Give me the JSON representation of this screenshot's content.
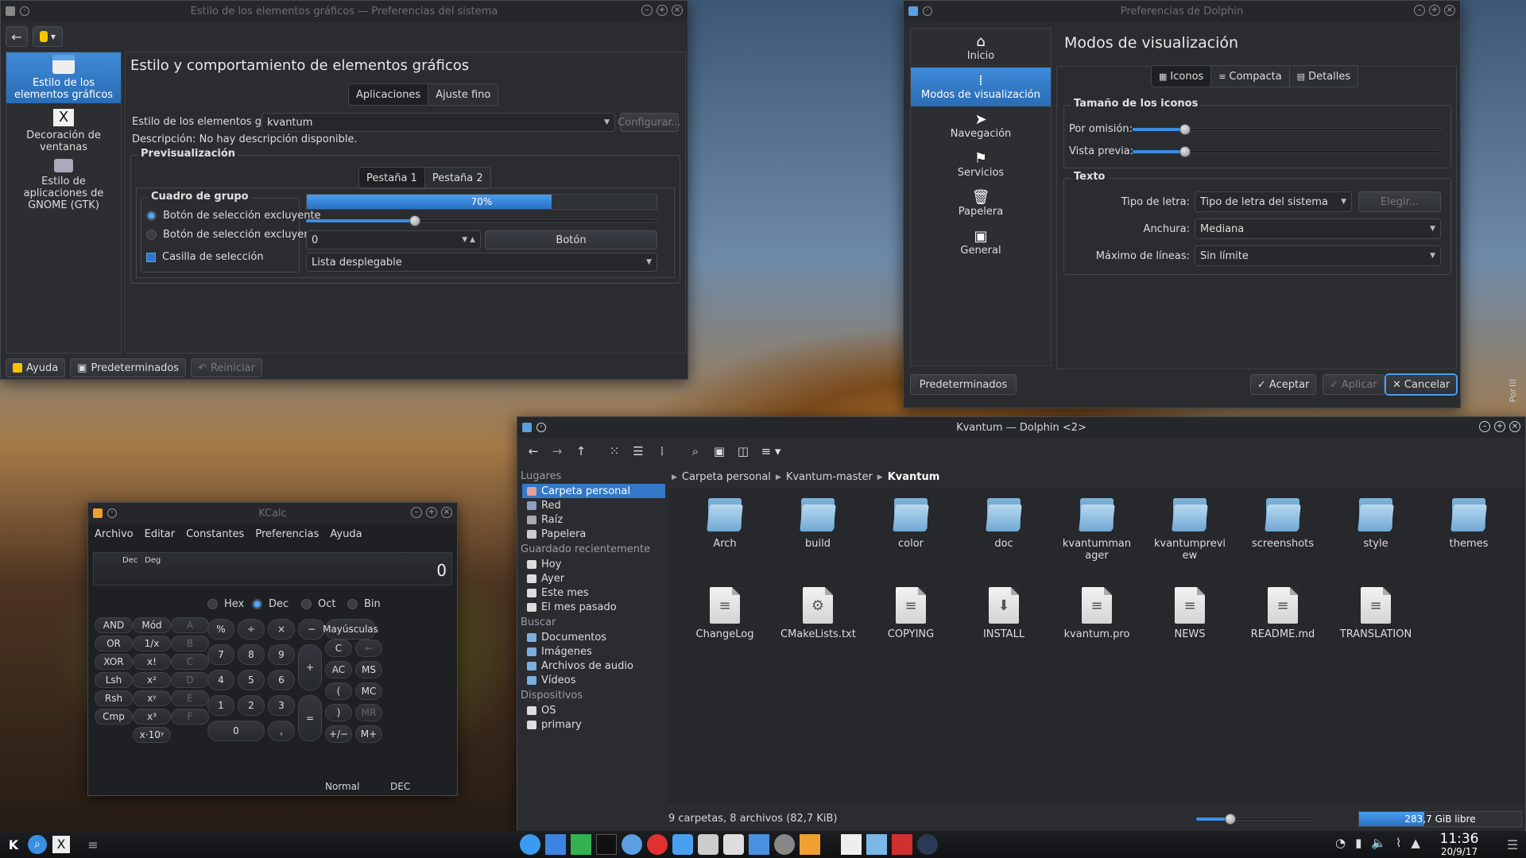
{
  "syswin": {
    "title": "Estilo de los elementos gráficos — Preferencias del sistema",
    "sidebar": [
      {
        "label": "Estilo de los elementos gráficos"
      },
      {
        "label": "Decoración de ventanas"
      },
      {
        "label": "Estilo de aplicaciones de GNOME (GTK)"
      }
    ],
    "heading": "Estilo y comportamiento de elementos gráficos",
    "tabs": [
      "Aplicaciones",
      "Ajuste fino"
    ],
    "style_label": "Estilo de los elementos gráficos:",
    "style_value": "kvantum",
    "configure": "Configurar...",
    "description": "Descripción: No hay descripción disponible.",
    "preview_title": "Previsualización",
    "preview_tabs": [
      "Pestaña 1",
      "Pestaña 2"
    ],
    "group_title": "Cuadro de grupo",
    "radio1": "Botón de selección excluyente",
    "radio2": "Botón de selección excluyente",
    "checkbox": "Casilla de selección",
    "progress": "70%",
    "progress_value": 0.7,
    "slider_value": 0.31,
    "spin_value": "0",
    "button": "Botón",
    "dropdown": "Lista desplegable",
    "footer": {
      "help": "Ayuda",
      "defaults": "Predeterminados",
      "reset": "Reiniciar"
    }
  },
  "dolphin_prefs": {
    "title": "Preferencias de Dolphin",
    "nav": [
      {
        "icon": "home-icon",
        "glyph": "⌂",
        "label": "Inicio"
      },
      {
        "icon": "view-modes-icon",
        "glyph": "⁞",
        "label": "Modos de visualización"
      },
      {
        "icon": "cursor-icon",
        "glyph": "➤",
        "label": "Navegación"
      },
      {
        "icon": "flag-icon",
        "glyph": "⚑",
        "label": "Servicios"
      },
      {
        "icon": "trash-icon",
        "glyph": "🗑",
        "label": "Papelera"
      },
      {
        "icon": "image-icon",
        "glyph": "▣",
        "label": "General"
      }
    ],
    "heading": "Modos de visualización",
    "view_tabs": [
      "Iconos",
      "Compacta",
      "Detalles"
    ],
    "icon_size_title": "Tamaño de los iconos",
    "default_label": "Por omisión:",
    "default_value": 0.17,
    "preview_label": "Vista previa:",
    "preview_value": 0.17,
    "text_title": "Texto",
    "font_label": "Tipo de letra:",
    "font_value": "Tipo de letra del sistema",
    "choose": "Elegir...",
    "width_label": "Anchura:",
    "width_value": "Mediana",
    "lines_label": "Máximo de líneas:",
    "lines_value": "Sin límite",
    "defaults": "Predeterminados",
    "accept": "Aceptar",
    "apply": "Aplicar",
    "cancel": "Cancelar"
  },
  "kcalc": {
    "title": "KCalc",
    "menu": [
      "Archivo",
      "Editar",
      "Constantes",
      "Preferencias",
      "Ayuda"
    ],
    "display_mode1": "Dec",
    "display_mode2": "Deg",
    "display_value": "0",
    "bases": [
      "Hex",
      "Dec",
      "Oct",
      "Bin"
    ],
    "left_col1": [
      "AND",
      "OR",
      "XOR",
      "Lsh",
      "Rsh",
      "Cmp"
    ],
    "left_col2": [
      "Mód",
      "1/x",
      "x!",
      "x²",
      "xʸ",
      "x³",
      "x·10ʸ"
    ],
    "hex_col": [
      "A",
      "B",
      "C",
      "D",
      "E",
      "F"
    ],
    "ops": [
      "%",
      "÷",
      "×",
      "−"
    ],
    "digits": [
      "7",
      "8",
      "9",
      "4",
      "5",
      "6",
      "1",
      "2",
      "3",
      "0",
      ","
    ],
    "plus": "+",
    "equals": "=",
    "mem_col1": [
      "C",
      "AC",
      "(",
      ")",
      "+/−"
    ],
    "mem_col2": [
      "←",
      "MS",
      "MC",
      "MR",
      "M+"
    ],
    "shift": "Mayúsculas",
    "status_mode": "Normal",
    "status_base": "DEC"
  },
  "dolphin": {
    "title": "Kvantum — Dolphin <2>",
    "places_title": "Lugares",
    "places": [
      "Carpeta personal",
      "Red",
      "Raíz",
      "Papelera"
    ],
    "recent_title": "Guardado recientemente",
    "recent": [
      "Hoy",
      "Ayer",
      "Este mes",
      "El mes pasado"
    ],
    "search_title": "Buscar",
    "search": [
      "Documentos",
      "Imágenes",
      "Archivos de audio",
      "Vídeos"
    ],
    "devices_title": "Dispositivos",
    "devices": [
      "OS",
      "primary"
    ],
    "breadcrumb": [
      "Carpeta personal",
      "Kvantum-master",
      "Kvantum"
    ],
    "folders": [
      "Arch",
      "build",
      "color",
      "doc",
      "kvantummanager",
      "kvantumpreview",
      "screenshots",
      "style",
      "themes"
    ],
    "files": [
      {
        "name": "ChangeLog",
        "icon": "text-file-icon",
        "glyph": "≡"
      },
      {
        "name": "CMakeLists.txt",
        "icon": "cmake-file-icon",
        "glyph": "⚙"
      },
      {
        "name": "COPYING",
        "icon": "text-file-icon",
        "glyph": "≡"
      },
      {
        "name": "INSTALL",
        "icon": "install-file-icon",
        "glyph": "⬇"
      },
      {
        "name": "kvantum.pro",
        "icon": "text-file-icon",
        "glyph": "≡"
      },
      {
        "name": "NEWS",
        "icon": "text-file-icon",
        "glyph": "≡"
      },
      {
        "name": "README.md",
        "icon": "text-file-icon",
        "glyph": "≡"
      },
      {
        "name": "TRANSLATION",
        "icon": "text-file-icon",
        "glyph": "≡"
      }
    ],
    "status": "9 carpetas, 8 archivos (82,7 KiB)",
    "free": "283,7 GiB libre"
  },
  "taskbar": {
    "time": "11:36",
    "date": "20/9/17",
    "side_label": "Por"
  },
  "colors": {
    "accent": "#3d8ee0",
    "window": "#2a2c30"
  }
}
